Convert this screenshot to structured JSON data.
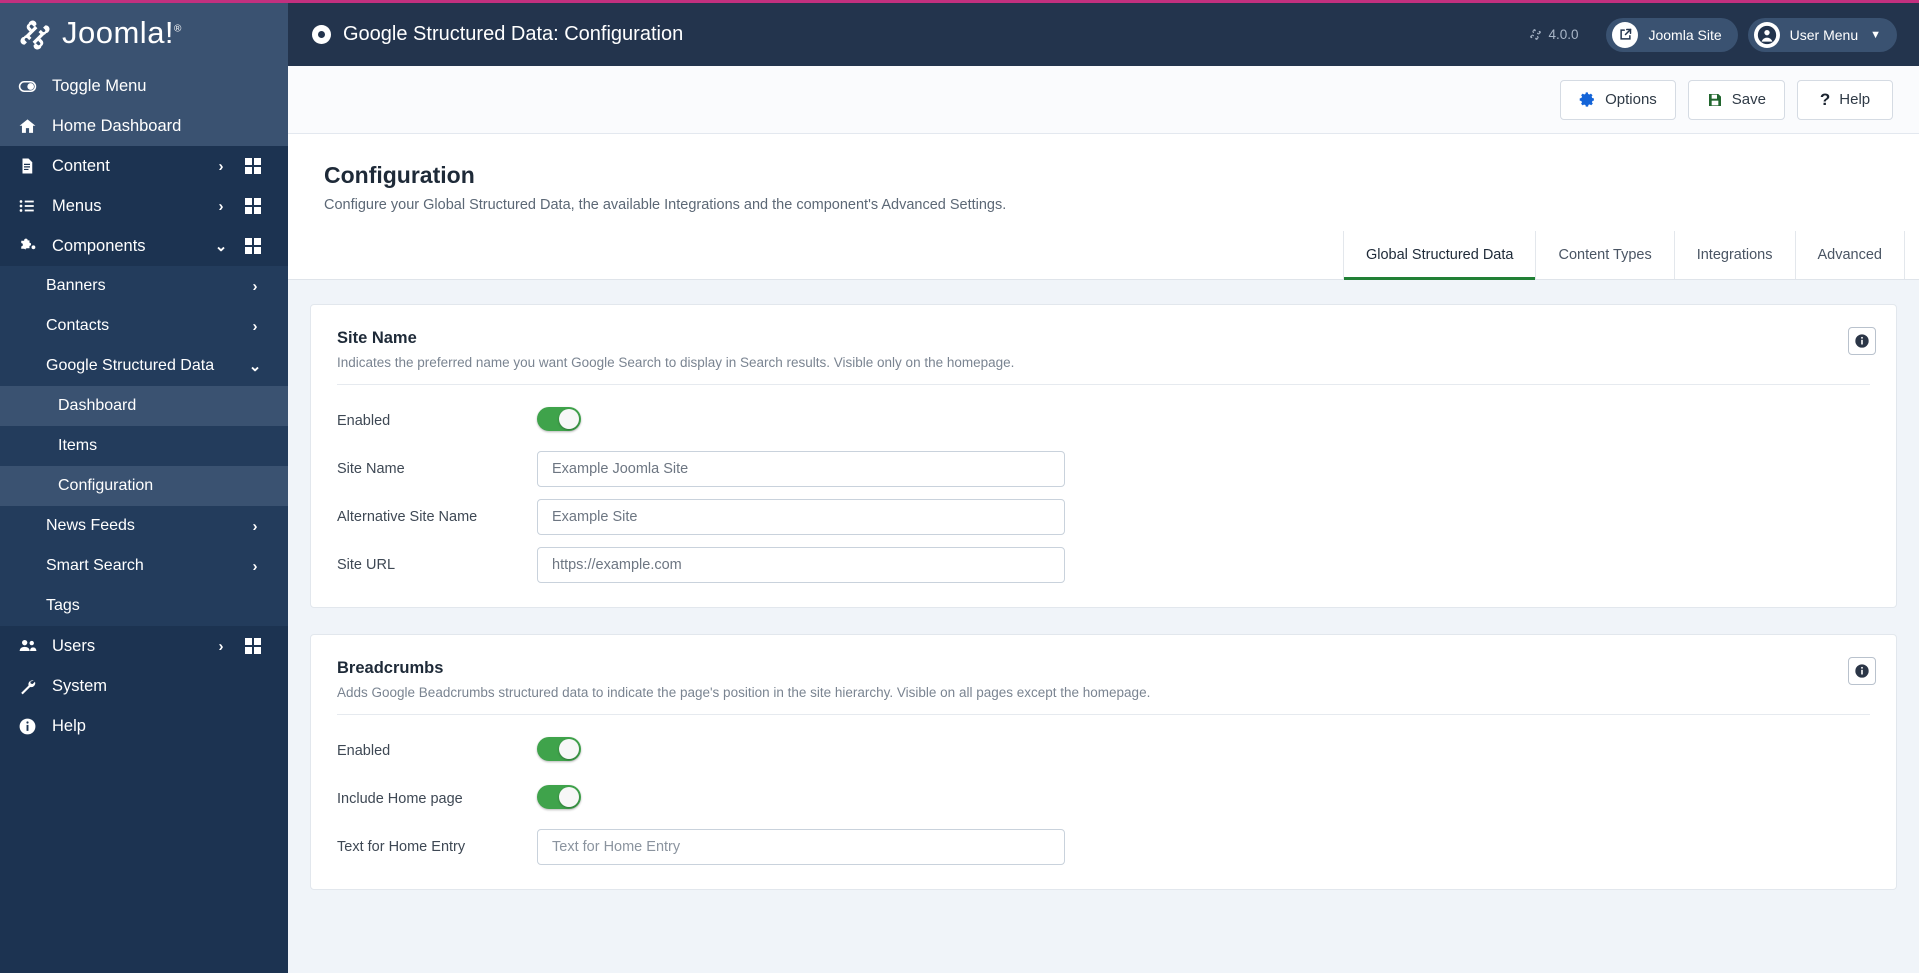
{
  "brand": {
    "name": "Joomla!",
    "trademark": "®"
  },
  "sidebar": {
    "items": [
      {
        "label": "Toggle Menu",
        "icon": "toggle-icon",
        "level": 1,
        "highlight": true,
        "chevron": "",
        "grid": false
      },
      {
        "label": "Home Dashboard",
        "icon": "home-icon",
        "level": 1,
        "highlight": true,
        "chevron": "",
        "grid": false
      },
      {
        "label": "Content",
        "icon": "document-icon",
        "level": 1,
        "highlight": false,
        "chevron": "›",
        "grid": true
      },
      {
        "label": "Menus",
        "icon": "list-icon",
        "level": 1,
        "highlight": false,
        "chevron": "›",
        "grid": true
      },
      {
        "label": "Components",
        "icon": "puzzle-icon",
        "level": 1,
        "highlight": false,
        "chevron": "⌄",
        "grid": true
      },
      {
        "label": "Banners",
        "icon": "",
        "level": 2,
        "highlight": false,
        "chevron": "›",
        "grid": false
      },
      {
        "label": "Contacts",
        "icon": "",
        "level": 2,
        "highlight": false,
        "chevron": "›",
        "grid": false
      },
      {
        "label": "Google Structured Data",
        "icon": "",
        "level": 2,
        "highlight": false,
        "chevron": "⌄",
        "grid": false
      },
      {
        "label": "Dashboard",
        "icon": "",
        "level": 3,
        "highlight": false,
        "chevron": "",
        "grid": false,
        "active": true
      },
      {
        "label": "Items",
        "icon": "",
        "level": 3,
        "highlight": false,
        "chevron": "",
        "grid": false
      },
      {
        "label": "Configuration",
        "icon": "",
        "level": 3,
        "highlight": false,
        "chevron": "",
        "grid": false,
        "active": true
      },
      {
        "label": "News Feeds",
        "icon": "",
        "level": 2,
        "highlight": false,
        "chevron": "›",
        "grid": false
      },
      {
        "label": "Smart Search",
        "icon": "",
        "level": 2,
        "highlight": false,
        "chevron": "›",
        "grid": false
      },
      {
        "label": "Tags",
        "icon": "",
        "level": 2,
        "highlight": false,
        "chevron": "",
        "grid": false
      },
      {
        "label": "Users",
        "icon": "users-icon",
        "level": 1,
        "highlight": false,
        "chevron": "›",
        "grid": true
      },
      {
        "label": "System",
        "icon": "wrench-icon",
        "level": 1,
        "highlight": false,
        "chevron": "",
        "grid": false
      },
      {
        "label": "Help",
        "icon": "info-icon",
        "level": 1,
        "highlight": false,
        "chevron": "",
        "grid": false
      }
    ]
  },
  "topbar": {
    "title": "Google Structured Data: Configuration",
    "version": "4.0.0",
    "site_button": "Joomla Site",
    "user_menu": "User Menu"
  },
  "toolbar": {
    "options_label": "Options",
    "save_label": "Save",
    "help_label": "Help"
  },
  "page": {
    "title": "Configuration",
    "description": "Configure your Global Structured Data, the available Integrations and the component's Advanced Settings."
  },
  "tabs": [
    {
      "label": "Global Structured Data",
      "active": true
    },
    {
      "label": "Content Types",
      "active": false
    },
    {
      "label": "Integrations",
      "active": false
    },
    {
      "label": "Advanced",
      "active": false
    }
  ],
  "cards": [
    {
      "title": "Site Name",
      "subtitle": "Indicates the preferred name you want Google Search to display in Search results. Visible only on the homepage.",
      "fields": [
        {
          "label": "Enabled",
          "type": "toggle",
          "value": "on"
        },
        {
          "label": "Site Name",
          "type": "text",
          "value": "Example Joomla Site",
          "placeholder": "Site Name"
        },
        {
          "label": "Alternative Site Name",
          "type": "text",
          "value": "Example Site",
          "placeholder": "Alternative Site Name"
        },
        {
          "label": "Site URL",
          "type": "text",
          "value": "https://example.com",
          "placeholder": "Site URL"
        }
      ]
    },
    {
      "title": "Breadcrumbs",
      "subtitle": "Adds Google Beadcrumbs structured data to indicate the page's position in the site hierarchy. Visible on all pages except the homepage.",
      "fields": [
        {
          "label": "Enabled",
          "type": "toggle",
          "value": "on"
        },
        {
          "label": "Include Home page",
          "type": "toggle",
          "value": "on"
        },
        {
          "label": "Text for Home Entry",
          "type": "text",
          "value": "",
          "placeholder": "Text for Home Entry"
        }
      ]
    }
  ],
  "colors": {
    "sidebar_bg": "#1c3351",
    "sidebar_active": "#3a5271",
    "topbar_bg": "#23344d",
    "accent_pink": "#c2307f",
    "toggle_on": "#3fa34b",
    "tab_underline": "#218035"
  }
}
